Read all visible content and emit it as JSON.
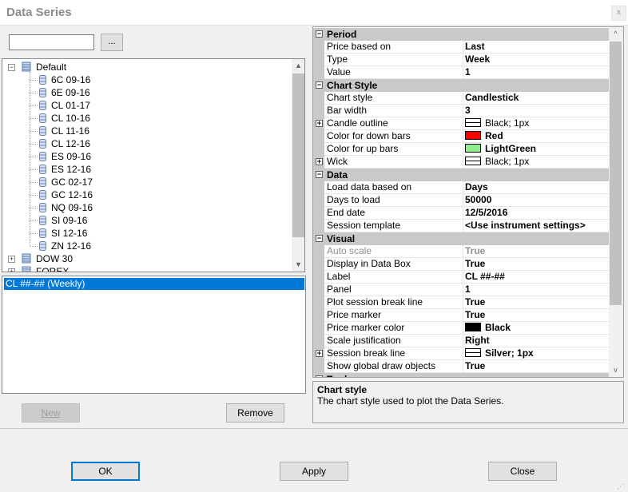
{
  "window": {
    "title": "Data Series",
    "close_glyph": "x"
  },
  "search": {
    "value": "",
    "browse_label": "..."
  },
  "tree": {
    "root_label": "Default",
    "children": [
      "6C 09-16",
      "6E 09-16",
      "CL 01-17",
      "CL 10-16",
      "CL 11-16",
      "CL 12-16",
      "ES 09-16",
      "ES 12-16",
      "GC 02-17",
      "GC 12-16",
      "NQ 09-16",
      "SI 09-16",
      "SI 12-16",
      "ZN 12-16"
    ],
    "other_groups": [
      "DOW 30",
      "FOREX"
    ]
  },
  "series_list": {
    "items": [
      "CL ##-## (Weekly)"
    ]
  },
  "left_buttons": {
    "new": "New",
    "remove": "Remove"
  },
  "properties": [
    {
      "category": "Period",
      "rows": [
        {
          "name": "Price based on",
          "value": "Last"
        },
        {
          "name": "Type",
          "value": "Week"
        },
        {
          "name": "Value",
          "value": "1"
        }
      ]
    },
    {
      "category": "Chart Style",
      "rows": [
        {
          "name": "Chart style",
          "value": "Candlestick"
        },
        {
          "name": "Bar width",
          "value": "3"
        },
        {
          "name": "Candle outline",
          "value": "Black; 1px",
          "expandable": true,
          "swatch": "line",
          "plain": true
        },
        {
          "name": "Color for down bars",
          "value": "Red",
          "swatch": "#ff0000"
        },
        {
          "name": "Color for up bars",
          "value": "LightGreen",
          "swatch": "#90ee90"
        },
        {
          "name": "Wick",
          "value": "Black; 1px",
          "expandable": true,
          "swatch": "line",
          "plain": true
        }
      ]
    },
    {
      "category": "Data",
      "rows": [
        {
          "name": "Load data based on",
          "value": "Days"
        },
        {
          "name": "Days to load",
          "value": "50000"
        },
        {
          "name": "End date",
          "value": "12/5/2016"
        },
        {
          "name": "Session template",
          "value": "<Use instrument settings>"
        }
      ]
    },
    {
      "category": "Visual",
      "rows": [
        {
          "name": "Auto scale",
          "value": "True",
          "disabled": true
        },
        {
          "name": "Display in Data Box",
          "value": "True"
        },
        {
          "name": "Label",
          "value": "CL ##-##"
        },
        {
          "name": "Panel",
          "value": "1"
        },
        {
          "name": "Plot session break line",
          "value": "True"
        },
        {
          "name": "Price marker",
          "value": "True"
        },
        {
          "name": "Price marker color",
          "value": "Black",
          "swatch": "#000000"
        },
        {
          "name": "Scale justification",
          "value": "Right"
        },
        {
          "name": "Session break line",
          "value": "Silver; 1px",
          "expandable": true,
          "swatch": "line"
        },
        {
          "name": "Show global draw objects",
          "value": "True"
        }
      ]
    },
    {
      "category": "Trades",
      "rows": []
    }
  ],
  "description": {
    "title": "Chart style",
    "text": "The chart style used to plot the Data Series."
  },
  "dialog_buttons": {
    "ok": "OK",
    "apply": "Apply",
    "close": "Close"
  }
}
